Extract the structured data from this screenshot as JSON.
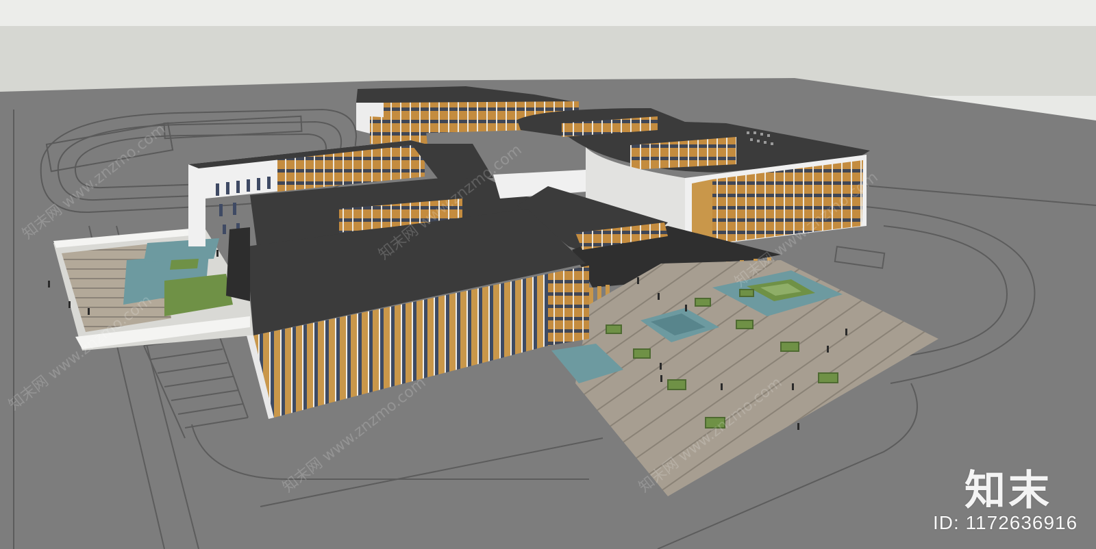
{
  "watermark": {
    "brand_text": "知末",
    "id_text": "ID: 1172636916",
    "repeated_text": "知末网 www.znzmo.com"
  },
  "colors": {
    "sky": "#d6d7d2",
    "ground": "#7d7d7d",
    "roof": "#3b3b3b",
    "facade_wood": "#c9974a",
    "facade_white": "#f0f0f0",
    "glass": "#3d4a63",
    "water": "#6d9aa0",
    "lawn": "#6f9146",
    "paving": "#a79e91"
  }
}
